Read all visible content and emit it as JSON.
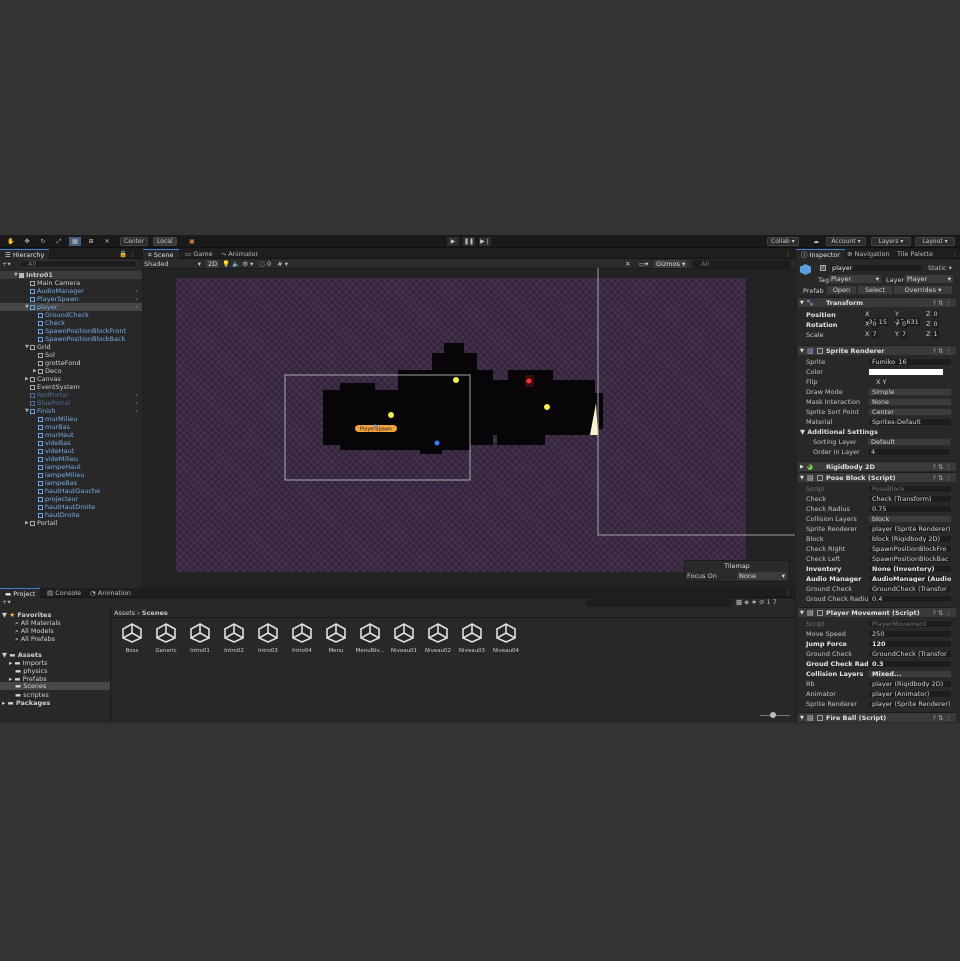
{
  "toolbar": {
    "center": "Center",
    "local": "Local",
    "collab": "Collab ▾",
    "account": "Account",
    "layers": "Layers",
    "layout": "Layout"
  },
  "hierarchy": {
    "tab": "Hierarchy",
    "search_placeholder": "All",
    "root": "Intro01",
    "items": [
      "Main Camera",
      "AudioManager",
      "PlayerSpawn",
      "player",
      "GroundCheck",
      "Check",
      "SpawnPositionBlockFront",
      "SpawnPositionBlockBack",
      "Grid",
      "Sol",
      "grotteFond",
      "Deco",
      "Canvas",
      "EventSystem",
      "RedPortal",
      "BluePortal",
      "Finish",
      "murMilieu",
      "murBas",
      "murHaut",
      "videBas",
      "videHaut",
      "videMilieu",
      "lampeHaut",
      "lampeMilieu",
      "lampeBas",
      "hautHautGauche",
      "projecteur",
      "hautHautDroite",
      "hautDroite",
      "Portail"
    ]
  },
  "scene": {
    "tabs": [
      "Scene",
      "Game",
      "Animator"
    ],
    "shading": "Shaded",
    "mode2d": "2D",
    "gizmos": "Gizmos",
    "search": "All",
    "layer_count": "0",
    "player_spawn_label": "PlayerSpawn",
    "tilemap": {
      "title": "Tilemap",
      "focus_label": "Focus On",
      "focus_value": "None"
    }
  },
  "inspector": {
    "tabs": [
      "Inspector",
      "Navigation",
      "Tile Palette"
    ],
    "name": "player",
    "static": "Static ▾",
    "tag_label": "Tag",
    "tag": "Player",
    "layer_label": "Layer",
    "layer": "Player",
    "prefab_label": "Prefab",
    "open": "Open",
    "select": "Select",
    "overrides": "Overrides",
    "transform": {
      "title": "Transform",
      "position": "Position",
      "rotation": "Rotation",
      "scale": "Scale",
      "px": "-36.15",
      "py": "17.631",
      "pz": "0",
      "rx": "0",
      "ry": "0",
      "rz": "0",
      "sx": "7",
      "sy": "7",
      "sz": "1"
    },
    "sprite_renderer": {
      "title": "Sprite Renderer",
      "fields": [
        [
          "Sprite",
          "Fumiko_16"
        ],
        [
          "Color",
          ""
        ],
        [
          "Flip",
          "X      Y"
        ],
        [
          "Draw Mode",
          "Simple"
        ],
        [
          "Mask Interaction",
          "None"
        ],
        [
          "Sprite Sort Point",
          "Center"
        ],
        [
          "Material",
          "Sprites-Default"
        ]
      ],
      "additional": "Additional Settings",
      "sorting_layer_label": "Sorting Layer",
      "sorting_layer": "Default",
      "order_label": "Order in Layer",
      "order": "4"
    },
    "rigidbody": {
      "title": "Rigidbody 2D"
    },
    "pose_block": {
      "title": "Pose Block (Script)",
      "fields": [
        [
          "Script",
          "PoseBlock"
        ],
        [
          "Check",
          "Check (Transform)"
        ],
        [
          "Check Radius",
          "0.75"
        ],
        [
          "Collision Layers",
          "block"
        ],
        [
          "Sprite Renderer",
          "player (Sprite Renderer)"
        ],
        [
          "Block",
          "block (Rigidbody 2D)"
        ],
        [
          "Check Right",
          "SpawnPositionBlockFro"
        ],
        [
          "Check Left",
          "SpawnPositionBlockBac"
        ],
        [
          "Inventory",
          "None (Inventory)"
        ],
        [
          "Audio Manager",
          "AudioManager (AudioM"
        ],
        [
          "Ground Check",
          "GroundCheck (Transfor"
        ],
        [
          "Groud Check Radius",
          "0.4"
        ]
      ]
    },
    "player_movement": {
      "title": "Player Movement (Script)",
      "fields": [
        [
          "Script",
          "PlayerMovement"
        ],
        [
          "Move Speed",
          "250"
        ],
        [
          "Jump Force",
          "120"
        ],
        [
          "Ground Check",
          "GroundCheck (Transfor"
        ],
        [
          "Groud Check Radius",
          "0.3"
        ],
        [
          "Collision Layers",
          "Mixed..."
        ],
        [
          "Rb",
          "player (Rigidbody 2D)"
        ],
        [
          "Animator",
          "player (Animator)"
        ],
        [
          "Sprite Renderer",
          "player (Sprite Renderer)"
        ]
      ]
    },
    "fire_ball": {
      "title": "Fire Ball (Script)"
    }
  },
  "project": {
    "tabs": [
      "Project",
      "Console",
      "Animation"
    ],
    "favorites": "Favorites",
    "fav_items": [
      "All Materials",
      "All Models",
      "All Prefabs"
    ],
    "assets": "Assets",
    "asset_folders": [
      "Imports",
      "physics",
      "Prefabs",
      "Scenes",
      "scriptes"
    ],
    "packages": "Packages",
    "breadcrumb": [
      "Assets",
      "Scenes"
    ],
    "count": "17",
    "scenes": [
      "Boss",
      "Generic",
      "Intro01",
      "Intro02",
      "Intro03",
      "Intro04",
      "Menu",
      "MenuNiv...",
      "Niveau01",
      "Niveau02",
      "Niveau03",
      "Niveau04"
    ]
  }
}
